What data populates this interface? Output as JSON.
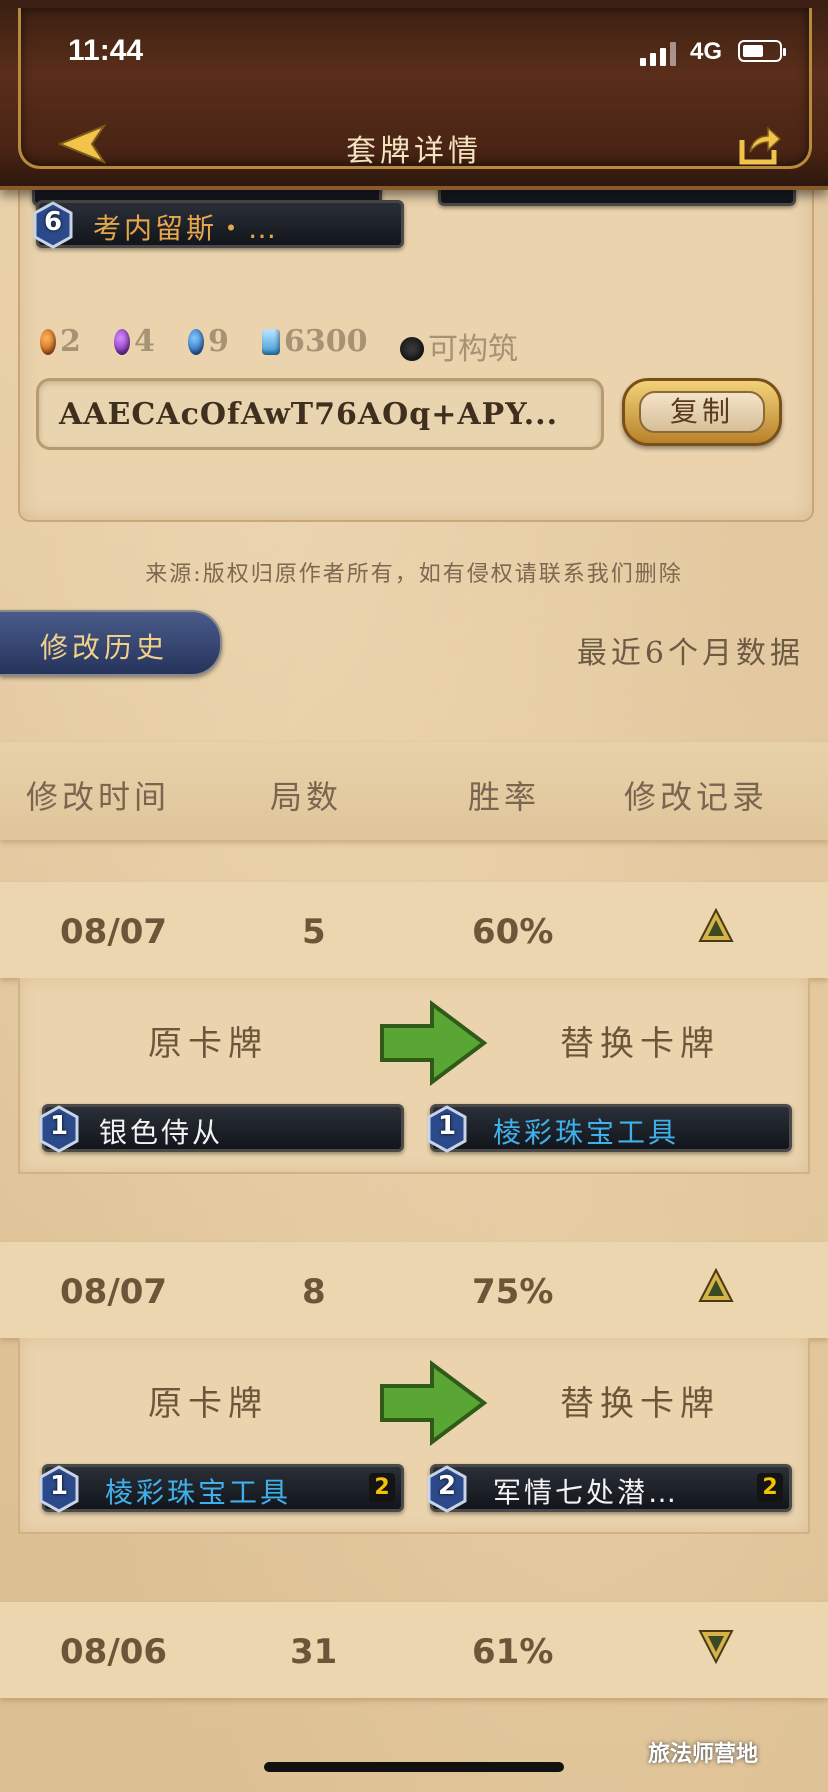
{
  "status_bar": {
    "time": "11:44",
    "network": "4G"
  },
  "header": {
    "title": "套牌详情",
    "back_icon": "back-arrow-icon",
    "share_icon": "share-icon"
  },
  "deck": {
    "card": {
      "cost": "6",
      "name": "考内留斯・…"
    },
    "dust": {
      "orange": "2",
      "purple": "4",
      "blue": "9",
      "total": "6300",
      "status": "可构筑"
    },
    "code": "AAECAcOfAwT76AOq+APY...",
    "copy_label": "复制"
  },
  "source": "来源:版权归原作者所有，如有侵权请联系我们删除",
  "history": {
    "tab_label": "修改历史",
    "range_label": "最近6个月数据"
  },
  "columns": [
    "修改时间",
    "局数",
    "胜率",
    "修改记录"
  ],
  "rows": [
    {
      "date": "08/07",
      "games": "5",
      "winrate": "60%",
      "trend": "up",
      "detail": {
        "original_label": "原卡牌",
        "replace_label": "替换卡牌",
        "original_card": {
          "cost": "1",
          "name": "银色侍从",
          "count": ""
        },
        "replace_card": {
          "cost": "1",
          "name": "棱彩珠宝工具",
          "count": ""
        }
      }
    },
    {
      "date": "08/07",
      "games": "8",
      "winrate": "75%",
      "trend": "up",
      "detail": {
        "original_label": "原卡牌",
        "replace_label": "替换卡牌",
        "original_card": {
          "cost": "1",
          "name": "棱彩珠宝工具",
          "count": "2"
        },
        "replace_card": {
          "cost": "2",
          "name": "军情七处潜…",
          "count": "2"
        }
      }
    },
    {
      "date": "08/06",
      "games": "31",
      "winrate": "61%",
      "trend": "down"
    }
  ],
  "watermark": "旅法师营地"
}
